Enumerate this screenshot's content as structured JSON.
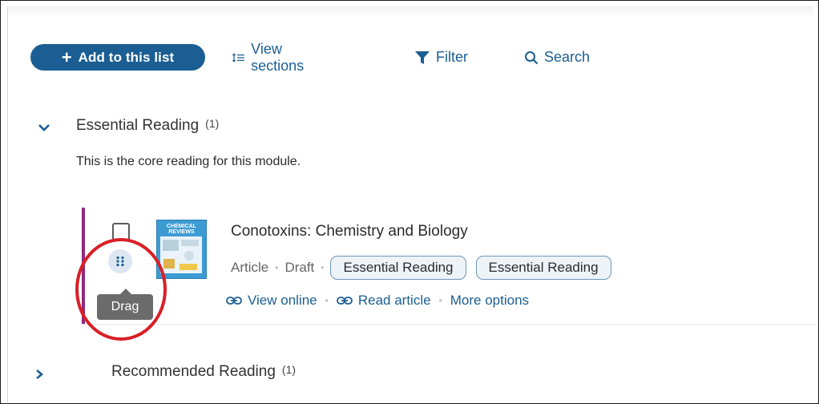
{
  "toolbar": {
    "add_label": "Add to this list",
    "view_sections_label": "View sections",
    "filter_label": "Filter",
    "search_label": "Search"
  },
  "sections": [
    {
      "title": "Essential Reading",
      "count": "(1)",
      "expanded": true,
      "description": "This is the core reading for this module."
    },
    {
      "title": "Recommended Reading",
      "count": "(1)",
      "expanded": false
    }
  ],
  "item": {
    "title": "Conotoxins: Chemistry and Biology",
    "type": "Article",
    "status": "Draft",
    "tags": [
      "Essential Reading",
      "Essential Reading"
    ],
    "thumbnail_title": "CHEMICAL REVIEWS",
    "drag_tooltip": "Drag",
    "actions": {
      "view_online": "View online",
      "read_article": "Read article",
      "more_options": "More options"
    },
    "accent_color": "#8e2a7e"
  },
  "colors": {
    "primary": "#1b5e93",
    "annotation": "#d91f26"
  },
  "icons": [
    "plus-icon",
    "view-sections-icon",
    "filter-icon",
    "search-icon",
    "chevron-down-icon",
    "chevron-right-icon",
    "drag-handle-icon",
    "link-icon"
  ]
}
